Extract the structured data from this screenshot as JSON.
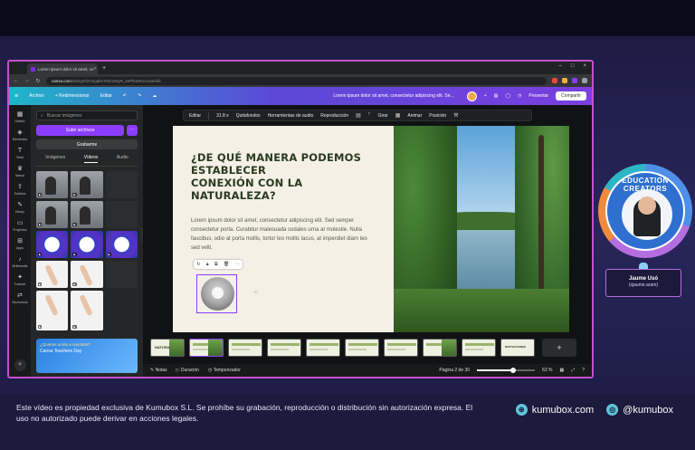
{
  "browser": {
    "tab_title": "Lorem ipsum dolor sit amet, co",
    "url_host": "canva.com",
    "url_path": "/design/DAGgalIe7eD/xNQR_s5Pbo6Ro2vaa/edit"
  },
  "canva_header": {
    "menu_archivo": "Archivo",
    "menu_redimensionar": "+ Redimensionar",
    "menu_editar": "Editar",
    "doc_title": "Lorem ipsum dolor sit amet, consectetur adipiscing elit. Se...",
    "present_label": "Presentar",
    "share_label": "Compartir"
  },
  "side_rail": [
    {
      "icon": "design-icon",
      "label": "Diseño"
    },
    {
      "icon": "elements-icon",
      "label": "Elementos"
    },
    {
      "icon": "text-icon",
      "label": "Texto"
    },
    {
      "icon": "brand-icon",
      "label": "Marca"
    },
    {
      "icon": "uploads-icon",
      "label": "Subidos"
    },
    {
      "icon": "draw-icon",
      "label": "Dibujo"
    },
    {
      "icon": "projects-icon",
      "label": "Proyectos"
    },
    {
      "icon": "apps-icon",
      "label": "Apps"
    },
    {
      "icon": "multimedia-icon",
      "label": "Multimedia"
    },
    {
      "icon": "magic-icon",
      "label": "Traducir"
    },
    {
      "icon": "sync-icon",
      "label": "Sincronizar"
    }
  ],
  "panel": {
    "search_placeholder": "Buscar imágenes",
    "upload_label": "Subir archivos",
    "upload_more": "···",
    "record_label": "Grabarme",
    "tabs": [
      "Imágenes",
      "Vídeos",
      "Audio"
    ],
    "active_tab": "Vídeos",
    "promo_line1": "¿Quieres unirte a nosotros?",
    "promo_line2": "Canva Teachers Day"
  },
  "toolbar": {
    "edit": "Editar",
    "duration": "31.8 s",
    "remove_bg": "Quitafondos",
    "audio_tools": "Herramientas de audio",
    "playback": "Reproducción",
    "crop": "Girar",
    "animate": "Animar",
    "position": "Posición"
  },
  "slide": {
    "title_line1": "¿DE QUÉ MANERA PODEMOS ESTABLECER",
    "title_line2": "CONEXIÓN CON LA NATURALEZA?",
    "body": "Lorem ipsum dolor sit amet, consectetur adipiscing elit. Sed semper consectetur porta. Curabitur malesuada sodales urna at molestie. Nulla faucibus, odio at porta mollis, tortor leo mollis lacus, at imperdiet diam leo sed velit."
  },
  "filmstrip": {
    "first_label": "NATURALEZA",
    "ninth_label": "MOTIVACIONES",
    "add_label": "+"
  },
  "statusbar": {
    "notes": "Notas",
    "duration": "Duración",
    "timer": "Temporizador",
    "page": "Página 2 de 30",
    "zoom": "63 %",
    "zoom_level": 0.63
  },
  "presenter": {
    "badge_text": "EDUCATION CREATORS",
    "name": "Jaume Usó",
    "handle": "(sjaume.aram)"
  },
  "footer": {
    "legal": "Este vídeo es propiedad exclusiva de Kumubox S.L. Se prohíbe su grabación, reproducción o distribución sin autorización expresa. El uso no autorizado puede derivar en acciones legales.",
    "site": "kumubox.com",
    "social": "@kumubox"
  }
}
